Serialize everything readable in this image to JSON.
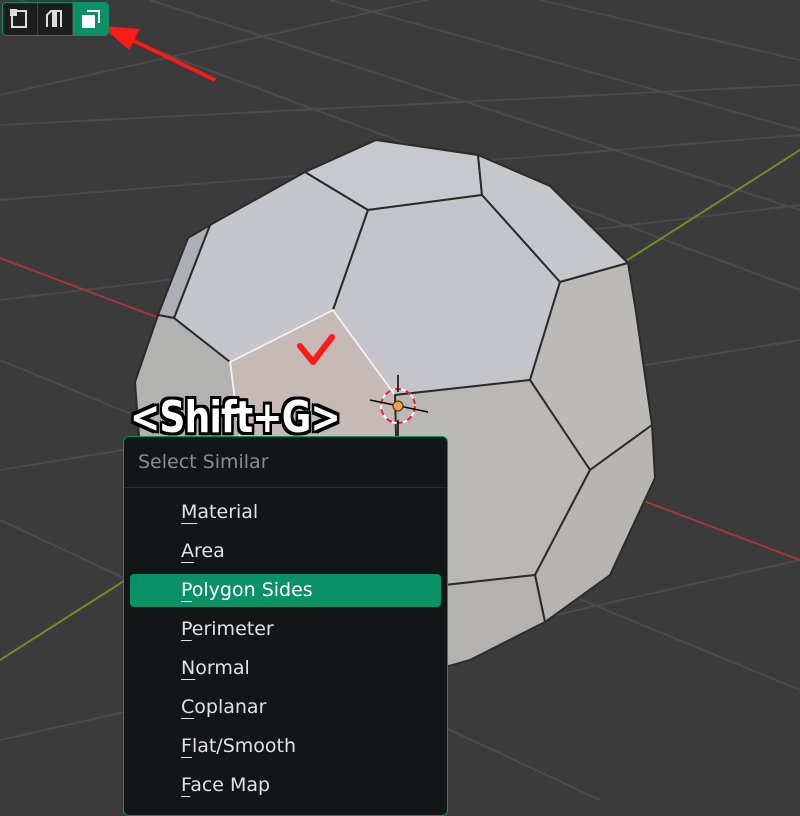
{
  "shortcut": "<Shift+G>",
  "select_mode": {
    "buttons": [
      {
        "name": "vertex-select-icon",
        "active": false
      },
      {
        "name": "edge-select-icon",
        "active": false
      },
      {
        "name": "face-select-icon",
        "active": true
      }
    ]
  },
  "menu": {
    "title": "Select Similar",
    "items": [
      {
        "label": "Material",
        "highlighted": false
      },
      {
        "label": "Area",
        "highlighted": false
      },
      {
        "label": "Polygon Sides",
        "highlighted": true
      },
      {
        "label": "Perimeter",
        "highlighted": false
      },
      {
        "label": "Normal",
        "highlighted": false
      },
      {
        "label": "Coplanar",
        "highlighted": false
      },
      {
        "label": "Flat/Smooth",
        "highlighted": false
      },
      {
        "label": "Face Map",
        "highlighted": false
      }
    ]
  },
  "colors": {
    "accent": "#0a9166",
    "annotation": "#ff1a1a",
    "x_axis": "#a8363f",
    "y_axis": "#6e8f2c"
  }
}
